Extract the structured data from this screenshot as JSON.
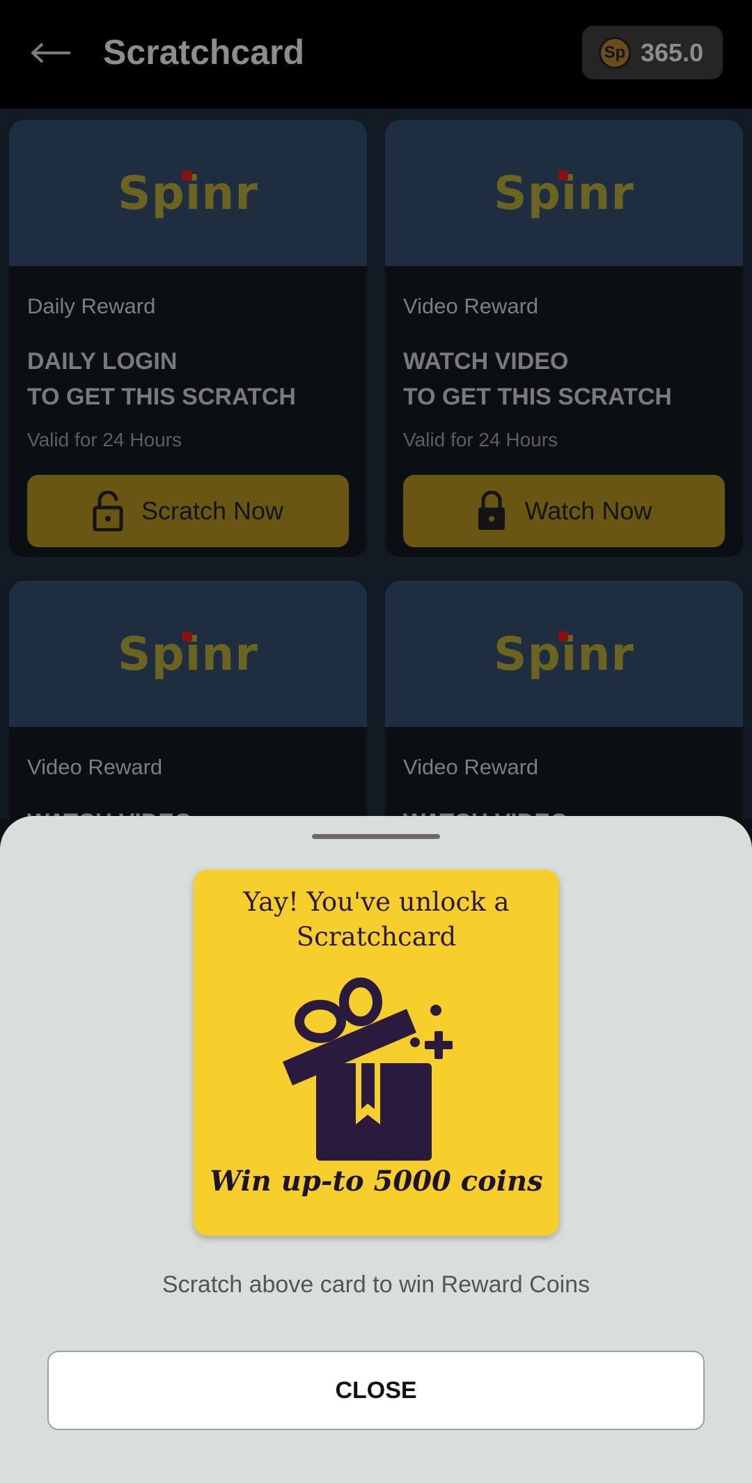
{
  "header": {
    "title": "Scratchcard",
    "back_icon": "arrow-left-icon",
    "coin_badge": {
      "icon": "Sp",
      "amount": "365.0"
    }
  },
  "cards": [
    {
      "logo": "Spinr",
      "reward_type": "Daily Reward",
      "headline_line1": "DAILY LOGIN",
      "headline_line2": "TO GET THIS SCRATCH",
      "validity": "Valid for 24 Hours",
      "action_label": "Scratch Now",
      "action_icon": "unlock-icon"
    },
    {
      "logo": "Spinr",
      "reward_type": "Video Reward",
      "headline_line1": "WATCH VIDEO",
      "headline_line2": "TO GET THIS SCRATCH",
      "validity": "Valid for 24 Hours",
      "action_label": "Watch Now",
      "action_icon": "lock-icon"
    },
    {
      "logo": "Spinr",
      "reward_type": "Video Reward",
      "headline_line1": "WATCH VIDEO"
    },
    {
      "logo": "Spinr",
      "reward_type": "Video Reward",
      "headline_line1": "WATCH VIDEO"
    }
  ],
  "sheet": {
    "scratch_card": {
      "title_line1": "Yay! You've unlock a",
      "title_line2": "Scratchcard",
      "icon": "gift-box-icon",
      "win_text": "Win up-to 5000 coins"
    },
    "caption": "Scratch above card to win Reward Coins",
    "close_label": "CLOSE"
  }
}
